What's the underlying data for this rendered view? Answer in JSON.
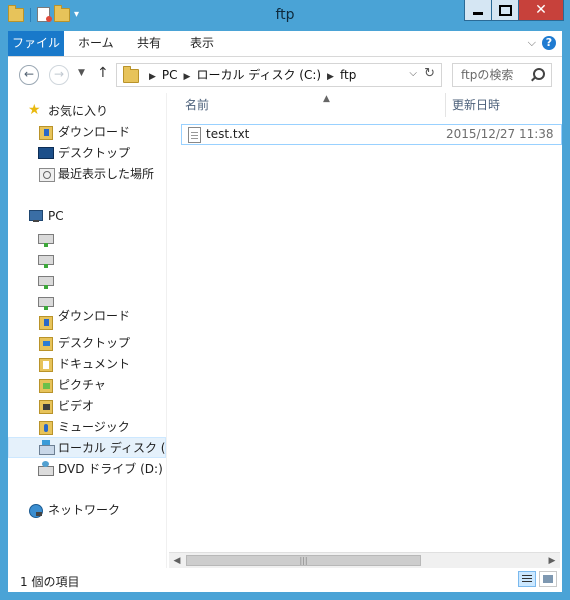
{
  "window": {
    "title": "ftp"
  },
  "ribbon": {
    "tabs": [
      "ファイル",
      "ホーム",
      "共有",
      "表示"
    ]
  },
  "address": {
    "crumbs": [
      "PC",
      "ローカル ディスク (C:)",
      "ftp"
    ],
    "search_placeholder": "ftpの検索"
  },
  "nav": {
    "favorites_label": "お気に入り",
    "favorites": [
      "ダウンロード",
      "デスクトップ",
      "最近表示した場所"
    ],
    "pc_label": "PC",
    "pc_items": [
      "ダウンロード",
      "デスクトップ",
      "ドキュメント",
      "ピクチャ",
      "ビデオ",
      "ミュージック",
      "ローカル ディスク (C:)",
      "DVD ドライブ (D:) IF"
    ],
    "network_label": "ネットワーク"
  },
  "columns": {
    "name": "名前",
    "date": "更新日時"
  },
  "files": [
    {
      "name": "test.txt",
      "modified": "2015/12/27 11:38"
    }
  ],
  "status": {
    "count_text": "1 個の項目"
  },
  "colors": {
    "frame": "#4aa3d6",
    "file_tab": "#1979ca",
    "close": "#c7413b",
    "selection": "#e5f1fb"
  }
}
